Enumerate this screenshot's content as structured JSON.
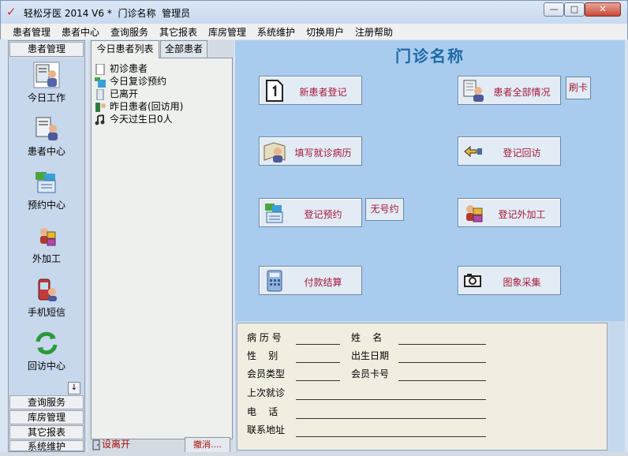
{
  "window": {
    "title": "轻松牙医 2014 V6 *  门诊名称  管理员",
    "min_glyph": "—",
    "max_glyph": "□",
    "close_glyph": "✕"
  },
  "menu": [
    "患者管理",
    "患者中心",
    "查询服务",
    "其它报表",
    "库房管理",
    "系统维护",
    "切换用户",
    "注册帮助"
  ],
  "leftbar": {
    "header": "患者管理",
    "items": [
      {
        "label": "今日工作",
        "icon": "today-work-icon"
      },
      {
        "label": "患者中心",
        "icon": "patient-center-icon"
      },
      {
        "label": "预约中心",
        "icon": "appointment-icon"
      },
      {
        "label": "外加工",
        "icon": "outsourcing-icon"
      },
      {
        "label": "手机短信",
        "icon": "sms-icon"
      },
      {
        "label": "回访中心",
        "icon": "followup-icon"
      }
    ],
    "scroll_glyph": "↓",
    "sections": [
      "查询服务",
      "库房管理",
      "其它报表",
      "系统维护"
    ]
  },
  "list_panel": {
    "tabs": [
      "今日患者列表",
      "全部患者"
    ],
    "rows": [
      "初诊患者",
      "今日复诊预约",
      "已离开",
      "昨日患者(回访用)",
      "今天过生日0人"
    ],
    "bottom_left": "设离开",
    "bottom_right": "撤消...."
  },
  "main": {
    "clinic_name": "门诊名称",
    "buttons": {
      "new_patient": "新患者登记",
      "all_patients": "患者全部情况",
      "swipe_card": "刷卡",
      "fill_record": "填写就诊病历",
      "followup": "登记回访",
      "appointment": "登记预约",
      "no_number": "无号约",
      "outsourcing": "登记外加工",
      "payment": "付款结算",
      "image_capture": "图象采集"
    }
  },
  "info": {
    "record_no": "病 历 号",
    "name": "姓    名",
    "gender": "性    别",
    "birth_date": "出生日期",
    "member_type": "会员类型",
    "member_card": "会员卡号",
    "last_visit": "上次就诊",
    "phone": "电    话",
    "address": "联系地址"
  }
}
